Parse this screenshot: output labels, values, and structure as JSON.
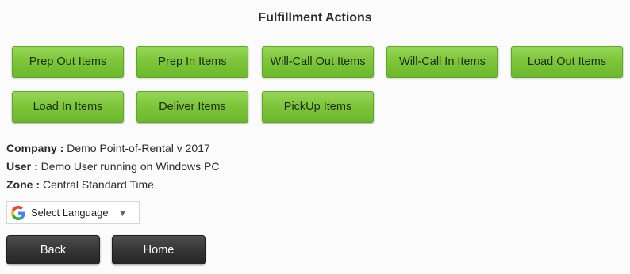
{
  "header": {
    "title": "Fulfillment Actions"
  },
  "actions": [
    {
      "label": "Prep Out Items"
    },
    {
      "label": "Prep In Items"
    },
    {
      "label": "Will-Call Out Items"
    },
    {
      "label": "Will-Call In Items"
    },
    {
      "label": "Load Out Items"
    },
    {
      "label": "Load In Items"
    },
    {
      "label": "Deliver Items"
    },
    {
      "label": "PickUp Items"
    }
  ],
  "info": {
    "company_label": "Company :",
    "company_value": "Demo Point-of-Rental v 2017",
    "user_label": "User :",
    "user_value": "Demo User running on Windows PC",
    "zone_label": "Zone :",
    "zone_value": "Central Standard Time"
  },
  "language": {
    "label": "Select Language",
    "icon": "google-g-icon",
    "arrow": "▼"
  },
  "nav": {
    "back_label": "Back",
    "home_label": "Home"
  },
  "colors": {
    "action_green": "#7ec63a",
    "nav_dark": "#343434",
    "background": "#fbfbfb"
  }
}
